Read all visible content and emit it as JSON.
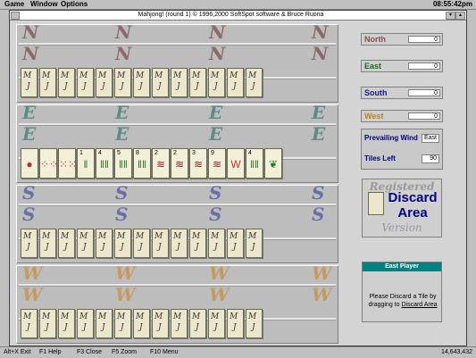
{
  "menu": {
    "items": [
      "Game",
      "Window",
      "Options"
    ],
    "clock": "08:55:42pm"
  },
  "window": {
    "title": "Mahjong! (round 1)  © 1996,2000 SoftSpot software & Bruce Ruona"
  },
  "panels": [
    {
      "wind": "N",
      "glyph_color": "#8a6a6a",
      "tile_count": 13,
      "tiles_face": false
    },
    {
      "wind": "E",
      "glyph_color": "#5f8a86",
      "tile_count": 14,
      "tiles_face": true
    },
    {
      "wind": "S",
      "glyph_color": "#6b6fa6",
      "tile_count": 13,
      "tiles_face": false
    },
    {
      "wind": "W",
      "glyph_color": "#c69a5e",
      "tile_count": 13,
      "tiles_face": false
    }
  ],
  "tile_back": {
    "top": "M",
    "bottom": "J"
  },
  "hand": [
    {
      "num": "",
      "sym": "●",
      "color": "#c0282a"
    },
    {
      "num": "",
      "sym": "⁘⁘",
      "color": "#c0282a"
    },
    {
      "num": "",
      "sym": "⁙⁙",
      "color": "#c0282a"
    },
    {
      "num": "1",
      "sym": "ǁ",
      "color": "#2d7a2d"
    },
    {
      "num": "4",
      "sym": "ǁǁ",
      "color": "#2d7a2d"
    },
    {
      "num": "5",
      "sym": "ǁǁ",
      "color": "#2d7a2d"
    },
    {
      "num": "8",
      "sym": "ǁǁ",
      "color": "#2d7a2d"
    },
    {
      "num": "2",
      "sym": "≋",
      "color": "#8a1a1a"
    },
    {
      "num": "2",
      "sym": "≋",
      "color": "#8a1a1a"
    },
    {
      "num": "3",
      "sym": "≋",
      "color": "#8a1a1a"
    },
    {
      "num": "9",
      "sym": "≋",
      "color": "#8a1a1a"
    },
    {
      "num": "",
      "sym": "W",
      "color": "#b83a2a"
    },
    {
      "num": "4",
      "sym": "ǁǁ",
      "color": "#2d7a2d"
    },
    {
      "num": "",
      "sym": "❦",
      "color": "#2d7a2d"
    }
  ],
  "winds": [
    {
      "name": "North",
      "score": "0",
      "color": "#8a4a4a"
    },
    {
      "name": "East",
      "score": "0",
      "color": "#1a6a1a"
    },
    {
      "name": "South",
      "score": "0",
      "color": "#1a1a80"
    },
    {
      "name": "West",
      "score": "0",
      "color": "#c0801a"
    }
  ],
  "info": {
    "prevailing_label": "Prevailing Wind",
    "prevailing_value": "East",
    "tiles_left_label": "Tiles Left",
    "tiles_left_value": "90"
  },
  "discard": {
    "registered": "Registered",
    "label_line1": "Discard",
    "label_line2": "Area",
    "version": "Version"
  },
  "player": {
    "header": "East Player",
    "message_prefix": "Please Discard a Tile by dragging to ",
    "message_link": "Discard Area"
  },
  "status": {
    "keys": [
      "Alt+X Exit",
      "F1 Help",
      "F3 Close",
      "F5 Zoom",
      "F10 Menu"
    ],
    "memory": "14,643,432"
  }
}
